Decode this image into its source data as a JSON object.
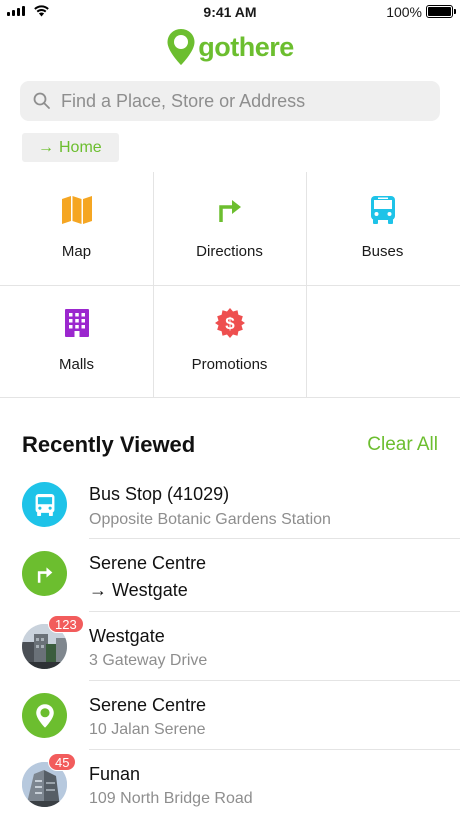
{
  "status_bar": {
    "time": "9:41 AM",
    "battery": "100%"
  },
  "logo": {
    "text": "gothere",
    "brand_color": "#6cbe2f"
  },
  "search": {
    "placeholder": "Find a Place, Store or Address"
  },
  "home_chip": {
    "arrow": "→",
    "label": "Home"
  },
  "tiles": [
    {
      "label": "Map",
      "icon": "map-icon",
      "color": "#f5a623"
    },
    {
      "label": "Directions",
      "icon": "turn-right-arrow-icon",
      "color": "#6cbe2f"
    },
    {
      "label": "Buses",
      "icon": "bus-icon",
      "color": "#1ec3e8"
    },
    {
      "label": "Malls",
      "icon": "building-icon",
      "color": "#9b27ce"
    },
    {
      "label": "Promotions",
      "icon": "dollar-badge-icon",
      "color": "#ee4f4f"
    }
  ],
  "recently_viewed": {
    "title": "Recently Viewed",
    "clear_label": "Clear All",
    "items": [
      {
        "title": "Bus Stop (41029)",
        "subtitle": "Opposite Botanic Gardens Station",
        "icon": "bus-icon",
        "color": "#1ec3e8"
      },
      {
        "title": "Serene Centre",
        "subtitle": "→ Westgate",
        "icon": "turn-right-arrow-icon",
        "color": "#6cbe2f"
      },
      {
        "title": "Westgate",
        "subtitle": "3 Gateway Drive",
        "icon": "mall-photo",
        "badge": "123"
      },
      {
        "title": "Serene Centre",
        "subtitle": "10 Jalan Serene",
        "icon": "location-pin-icon",
        "color": "#6cbe2f"
      },
      {
        "title": "Funan",
        "subtitle": "109 North Bridge Road",
        "icon": "mall-photo",
        "badge": "45"
      }
    ]
  }
}
